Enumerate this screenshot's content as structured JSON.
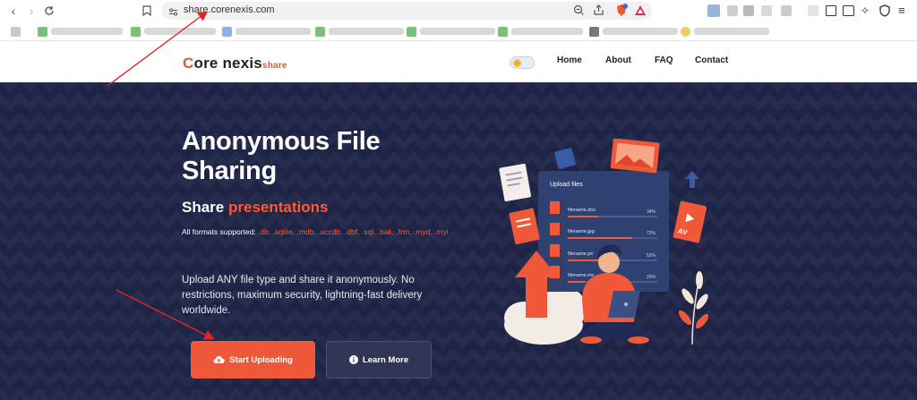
{
  "browser": {
    "url": "share.corenexis.com",
    "back_icon": "chevron-left-icon",
    "forward_icon": "chevron-right-icon",
    "reload_icon": "reload-icon"
  },
  "site": {
    "logo_initial": "C",
    "logo_rest": "ore nexis",
    "logo_suffix": "share",
    "nav": {
      "home": "Home",
      "about": "About",
      "faq": "FAQ",
      "contact": "Contact"
    }
  },
  "hero": {
    "title": "Anonymous File Sharing",
    "subtitle_prefix": "Share ",
    "subtitle_highlight": "presentations",
    "formats_prefix": "All formats supported: ",
    "formats_list": ".db, .sqlite, .mdb, .accdb, .dbf, .sql, .bak, .frm, .myd, .myi",
    "description": "Upload ANY file type and share it anonymously. No restrictions, maximum security, lightning-fast delivery worldwide.",
    "primary_button": "Start Uploading",
    "secondary_button": "Learn More"
  },
  "illustration": {
    "panel_title": "Upload files",
    "files": [
      {
        "name": "filename.doc",
        "progress": "34%"
      },
      {
        "name": "filename.jpg",
        "progress": "72%"
      },
      {
        "name": "filename.pn",
        "progress": "52%"
      },
      {
        "name": "filename.mc",
        "progress": "20%"
      }
    ],
    "video_badge": "AV"
  },
  "colors": {
    "accent": "#f0583a",
    "hero_bg": "#1d2445",
    "annotation": "#e32525"
  }
}
